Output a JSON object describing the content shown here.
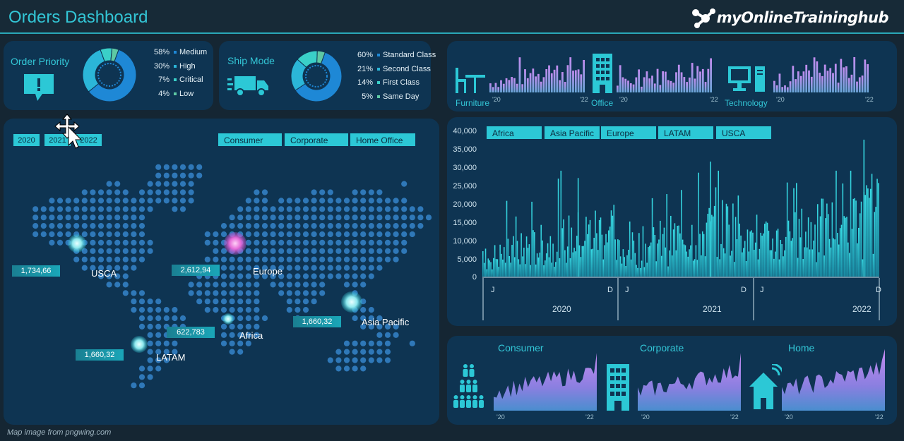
{
  "header": {
    "title": "Orders Dashboard",
    "brand": "myOnlineTraininghub"
  },
  "order_priority": {
    "label": "Order Priority",
    "items": [
      {
        "pct": "58%",
        "name": "Medium",
        "value": 58,
        "color": "#1e88d6"
      },
      {
        "pct": "30%",
        "name": "High",
        "value": 30,
        "color": "#2bb6d8"
      },
      {
        "pct": "7%",
        "name": "Critical",
        "value": 7,
        "color": "#3ad0c8"
      },
      {
        "pct": "4%",
        "name": "Low",
        "value": 4,
        "color": "#5ec9a4"
      }
    ]
  },
  "ship_mode": {
    "label": "Ship Mode",
    "items": [
      {
        "pct": "60%",
        "name": "Standard Class",
        "value": 60,
        "color": "#1e88d6"
      },
      {
        "pct": "21%",
        "name": "Second Class",
        "value": 21,
        "color": "#2bb6d8"
      },
      {
        "pct": "14%",
        "name": "First Class",
        "value": 14,
        "color": "#3ad0c8"
      },
      {
        "pct": "5%",
        "name": "Same Day",
        "value": 5,
        "color": "#5ec9a4"
      }
    ]
  },
  "categories": [
    {
      "name": "Furniture",
      "x_start": "'20",
      "x_end": "'22"
    },
    {
      "name": "Office",
      "x_start": "'20",
      "x_end": "'22"
    },
    {
      "name": "Technology",
      "x_start": "'20",
      "x_end": "'22"
    }
  ],
  "year_slicer": [
    "2020",
    "2021",
    "2022"
  ],
  "segment_slicer": [
    "Consumer",
    "Corporate",
    "Home Office"
  ],
  "region_slicer": [
    "Africa",
    "Asia Pacific",
    "Europe",
    "LATAM",
    "USCA"
  ],
  "map": {
    "regions": [
      {
        "name": "USCA",
        "value": "1,734,66"
      },
      {
        "name": "Europe",
        "value": "2,612,94"
      },
      {
        "name": "Africa",
        "value": "622,783"
      },
      {
        "name": "Asia Pacific",
        "value": "1,660,32"
      },
      {
        "name": "LATAM",
        "value": "1,660,32"
      }
    ]
  },
  "chart_data": {
    "type": "bar",
    "yticks": [
      "40,000",
      "35,000",
      "30,000",
      "25,000",
      "20,000",
      "15,000",
      "10,000",
      "5,000",
      "0"
    ],
    "ylim": [
      0,
      40000
    ],
    "years": [
      "2020",
      "2021",
      "2022"
    ],
    "month_start": "J",
    "month_end": "D",
    "peaks": [
      {
        "x": "2020",
        "y": 27000
      },
      {
        "x": "2021",
        "y": 31500
      },
      {
        "x": "2022",
        "y": 37500
      }
    ]
  },
  "segments": [
    {
      "name": "Consumer",
      "x_start": "'20",
      "x_end": "'22"
    },
    {
      "name": "Corporate",
      "x_start": "'20",
      "x_end": "'22"
    },
    {
      "name": "Home",
      "x_start": "'20",
      "x_end": "'22"
    }
  ],
  "footer": "Map image from pngwing.com",
  "colors": {
    "accent": "#33c6d6",
    "panel": "#0e3452",
    "background": "#152633",
    "bar": "#2cc8d6",
    "purple": "#b07de0"
  }
}
